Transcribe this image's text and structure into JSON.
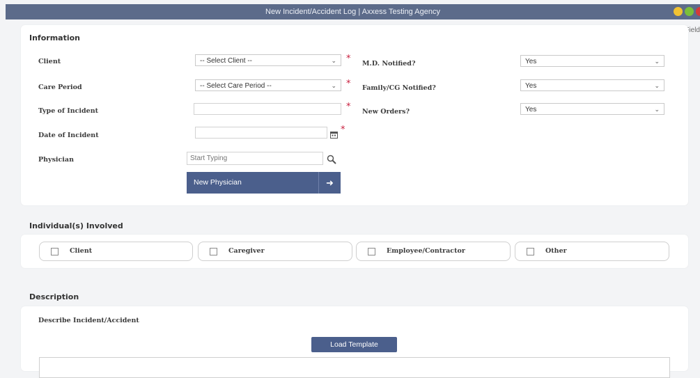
{
  "window": {
    "title": "New Incident/Accident Log | Axxess Testing Agency",
    "buttons": {
      "minimize_color": "#f1c232",
      "maximize_color": "#7bbf3a",
      "close_color": "#d43a3a"
    }
  },
  "legend": {
    "star": "*",
    "text": "= Required Field"
  },
  "information": {
    "title": "Information",
    "client": {
      "label": "Client",
      "value": "-- Select Client --"
    },
    "care_period": {
      "label": "Care Period",
      "value": "-- Select Care Period --"
    },
    "type_of_incident": {
      "label": "Type of Incident",
      "value": ""
    },
    "date_of_incident": {
      "label": "Date of Incident",
      "value": ""
    },
    "physician": {
      "label": "Physician",
      "placeholder": "Start Typing"
    },
    "new_physician_button": "New Physician",
    "md_notified": {
      "label": "M.D. Notified?",
      "value": "Yes"
    },
    "family_notified": {
      "label": "Family/CG Notified?",
      "value": "Yes"
    },
    "new_orders": {
      "label": "New Orders?",
      "value": "Yes"
    }
  },
  "individuals": {
    "title": "Individual(s) Involved",
    "options": [
      "Client",
      "Caregiver",
      "Employee/Contractor",
      "Other"
    ]
  },
  "description": {
    "title": "Description",
    "field_label": "Describe Incident/Accident",
    "load_template_button": "Load Template"
  },
  "colors": {
    "titlebar": "#5c6b8a",
    "accent": "#4b5f8c",
    "required": "#c8203f"
  }
}
